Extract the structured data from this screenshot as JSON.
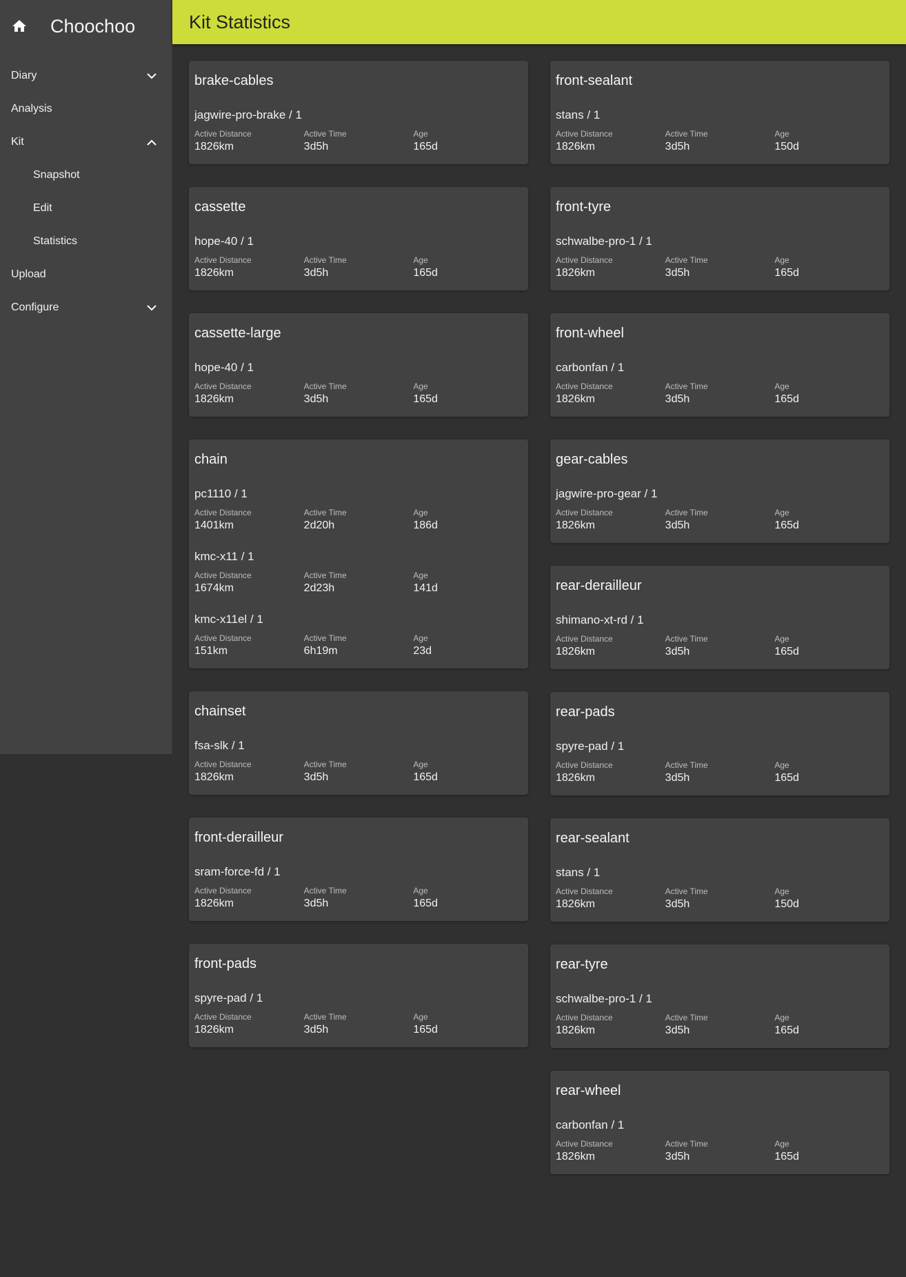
{
  "app": {
    "title": "Choochoo",
    "home_icon": "home-icon"
  },
  "sidebar": {
    "items": [
      {
        "label": "Diary",
        "chevron": "down"
      },
      {
        "label": "Analysis"
      },
      {
        "label": "Kit",
        "chevron": "up"
      },
      {
        "label": "Snapshot",
        "sub": true
      },
      {
        "label": "Edit",
        "sub": true
      },
      {
        "label": "Statistics",
        "sub": true
      },
      {
        "label": "Upload"
      },
      {
        "label": "Configure",
        "chevron": "down"
      }
    ]
  },
  "header": {
    "title": "Kit Statistics",
    "accent": "#cddc39"
  },
  "labels": {
    "distance": "Active Distance",
    "time": "Active Time",
    "age": "Age"
  },
  "left_cards": [
    {
      "title": "brake-cables",
      "items": [
        {
          "name": "jagwire-pro-brake / 1",
          "distance": "1826km",
          "time": "3d5h",
          "age": "165d"
        }
      ]
    },
    {
      "title": "cassette",
      "items": [
        {
          "name": "hope-40 / 1",
          "distance": "1826km",
          "time": "3d5h",
          "age": "165d"
        }
      ]
    },
    {
      "title": "cassette-large",
      "items": [
        {
          "name": "hope-40 / 1",
          "distance": "1826km",
          "time": "3d5h",
          "age": "165d"
        }
      ]
    },
    {
      "title": "chain",
      "items": [
        {
          "name": "pc1110 / 1",
          "distance": "1401km",
          "time": "2d20h",
          "age": "186d"
        },
        {
          "name": "kmc-x11 / 1",
          "distance": "1674km",
          "time": "2d23h",
          "age": "141d"
        },
        {
          "name": "kmc-x11el / 1",
          "distance": "151km",
          "time": "6h19m",
          "age": "23d"
        }
      ]
    },
    {
      "title": "chainset",
      "items": [
        {
          "name": "fsa-slk / 1",
          "distance": "1826km",
          "time": "3d5h",
          "age": "165d"
        }
      ]
    },
    {
      "title": "front-derailleur",
      "items": [
        {
          "name": "sram-force-fd / 1",
          "distance": "1826km",
          "time": "3d5h",
          "age": "165d"
        }
      ]
    },
    {
      "title": "front-pads",
      "items": [
        {
          "name": "spyre-pad / 1",
          "distance": "1826km",
          "time": "3d5h",
          "age": "165d"
        }
      ]
    }
  ],
  "right_cards": [
    {
      "title": "front-sealant",
      "items": [
        {
          "name": "stans / 1",
          "distance": "1826km",
          "time": "3d5h",
          "age": "150d"
        }
      ]
    },
    {
      "title": "front-tyre",
      "items": [
        {
          "name": "schwalbe-pro-1 / 1",
          "distance": "1826km",
          "time": "3d5h",
          "age": "165d"
        }
      ]
    },
    {
      "title": "front-wheel",
      "items": [
        {
          "name": "carbonfan / 1",
          "distance": "1826km",
          "time": "3d5h",
          "age": "165d"
        }
      ]
    },
    {
      "title": "gear-cables",
      "items": [
        {
          "name": "jagwire-pro-gear / 1",
          "distance": "1826km",
          "time": "3d5h",
          "age": "165d"
        }
      ]
    },
    {
      "title": "rear-derailleur",
      "items": [
        {
          "name": "shimano-xt-rd / 1",
          "distance": "1826km",
          "time": "3d5h",
          "age": "165d"
        }
      ]
    },
    {
      "title": "rear-pads",
      "items": [
        {
          "name": "spyre-pad / 1",
          "distance": "1826km",
          "time": "3d5h",
          "age": "165d"
        }
      ]
    },
    {
      "title": "rear-sealant",
      "items": [
        {
          "name": "stans / 1",
          "distance": "1826km",
          "time": "3d5h",
          "age": "150d"
        }
      ]
    },
    {
      "title": "rear-tyre",
      "items": [
        {
          "name": "schwalbe-pro-1 / 1",
          "distance": "1826km",
          "time": "3d5h",
          "age": "165d"
        }
      ]
    },
    {
      "title": "rear-wheel",
      "items": [
        {
          "name": "carbonfan / 1",
          "distance": "1826km",
          "time": "3d5h",
          "age": "165d"
        }
      ]
    }
  ]
}
